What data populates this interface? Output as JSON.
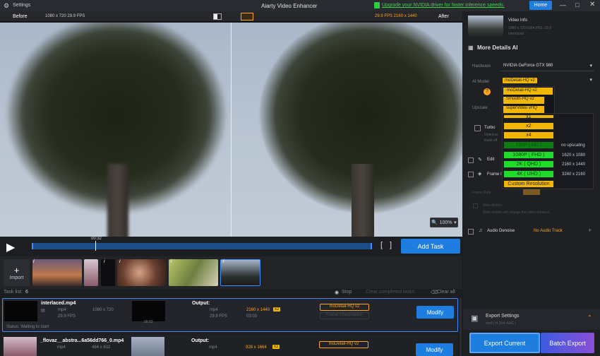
{
  "app": {
    "title": "Aiarty Video Enhancer",
    "settings": "Settings",
    "upgrade_notice": "Upgrade your NVIDIA driver for faster inference speeds.",
    "home": "Home"
  },
  "preview": {
    "before": "Before",
    "after": "After",
    "before_info": "1080 x 720  29.9 FPS",
    "after_info": "29.9 FPS  2160 x 1440",
    "zoom": "100%",
    "time": "00:32",
    "add_task": "Add Task"
  },
  "video_info": {
    "title": "Video Info",
    "details": "1080 x 720  h264  FPS: 29.9",
    "sub": "Interlaced"
  },
  "ai_panel": {
    "section": "More Details AI",
    "hardware_label": "Hardware",
    "hardware_value": "NVIDIA GeForce GTX 980",
    "model_label": "AI Model",
    "model_value": "moDetail-HQ  v2",
    "upscale_label": "Upscale",
    "turbo_label": "Turbo",
    "turbo_sub1": "Optimize",
    "turbo_sub2": "trade-off",
    "edit_label": "Edit",
    "frame_label": "Frame I",
    "frame_rate": "Frame Rate",
    "slow_motion": "Slow Motion",
    "slow_desc": "Slow motion will change the video duration.",
    "audio_label": "Audio Denoise",
    "audio_value": "No Audio Track",
    "export_settings": "Export Settings",
    "export_sub": "mp4 | H.264, AAC |",
    "export_current": "Export Current",
    "batch_export": "Batch Export"
  },
  "model_dropdown": [
    "moDetail-HQ  v2",
    "Smooth-HQ  v2",
    "superVideo vHQ"
  ],
  "upscale_dropdown": [
    {
      "label": "x1",
      "res": ""
    },
    {
      "label": "x2",
      "res": ""
    },
    {
      "label": "x4",
      "res": ""
    },
    {
      "label": "720P  ( HD )",
      "res": "no upscaling"
    },
    {
      "label": "1080P  ( FHD )",
      "res": "1620 x 1080"
    },
    {
      "label": "2K  ( QHD )",
      "res": "2160 x 1440"
    },
    {
      "label": "4K  ( UHD )",
      "res": "3240 x 2160"
    },
    {
      "label": "Custom Resolution",
      "res": ""
    }
  ],
  "import": "Import",
  "tasks": {
    "header": "Task list:",
    "count": "6",
    "stop": "Stop",
    "clear_completed": "Clear completed tasks",
    "clear_all": "Clear all",
    "items": [
      {
        "name": "interlaced.mp4",
        "fmt": "mp4",
        "res": "1080 x 720",
        "fps": "29.9 FPS",
        "output_label": "Output:",
        "out_fmt": "mp4",
        "out_res": "2160 x 1440",
        "out_fps": "29.9 FPS",
        "duration": "03:03",
        "scale": "x2",
        "model": "moDetail-HQ  v2",
        "model2": "Frame Interpolation",
        "modify": "Modify",
        "status": "Status: Waiting to start",
        "time": "00:03"
      },
      {
        "name": "_flovaz__abstra...6a56dd766_0.mp4",
        "fmt": "mp4",
        "res": "464 x 832",
        "output_label": "Output:",
        "out_fmt": "mp4",
        "out_res": "928 x 1664",
        "scale": "x2",
        "model": "moDetail-HQ  v2",
        "modify": "Modify"
      }
    ]
  },
  "colors": {
    "accent": "#1e7ee0",
    "orange": "#ffa31a",
    "green": "#1fdc2a",
    "yellow": "#f2b705"
  }
}
